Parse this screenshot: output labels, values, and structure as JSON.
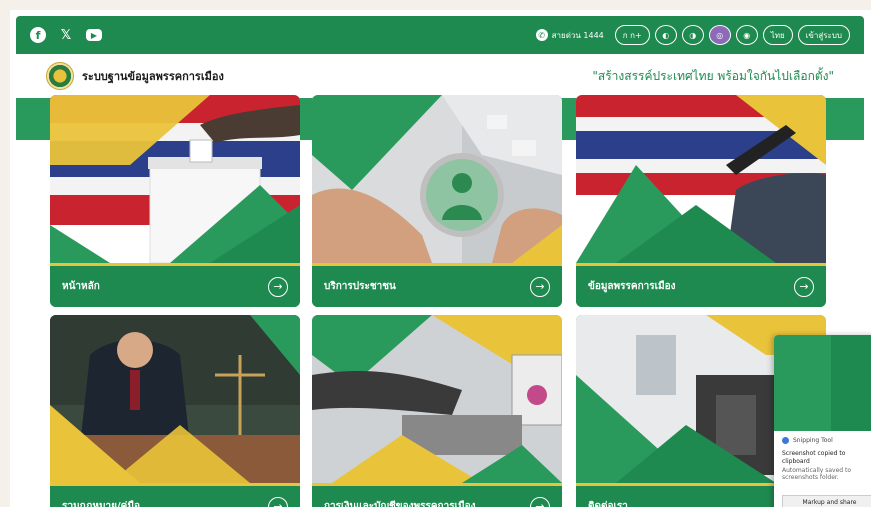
{
  "topbar": {
    "social": [
      "f",
      "𝕏",
      "▶"
    ],
    "hotline": "สายด่วน 1444",
    "buttons": [
      {
        "label": "ก ก+",
        "type": "pill"
      },
      {
        "label": "◐",
        "type": "circ"
      },
      {
        "label": "◑",
        "type": "circ"
      },
      {
        "label": "◎",
        "type": "circ-active"
      },
      {
        "label": "◉",
        "type": "circ"
      },
      {
        "label": "ไทย",
        "type": "pill"
      },
      {
        "label": "เข้าสู่ระบบ",
        "type": "pill"
      }
    ]
  },
  "header": {
    "site_name": "ระบบฐานข้อมูลพรรคการเมือง",
    "slogan": "\"สร้างสรรค์ประเทศไทย พร้อมใจกันไปเลือกตั้ง\""
  },
  "cards": [
    {
      "label": "หน้าหลัก",
      "scene": "ballot"
    },
    {
      "label": "บริการประชาชน",
      "scene": "magnifier"
    },
    {
      "label": "ข้อมูลพรรคการเมือง",
      "scene": "podium"
    },
    {
      "label": "รวมกฎหมาย/คู่มือ",
      "scene": "law"
    },
    {
      "label": "การเงินและบัญชีของพรรคการเมือง",
      "scene": "finance"
    },
    {
      "label": "ติดต่อเรา",
      "scene": "contact"
    }
  ],
  "arrow_icon": "→",
  "toast": {
    "app": "Snipping Tool",
    "message": "Screenshot copied to clipboard",
    "sub": "Automatically saved to screenshots folder.",
    "button": "Markup and share"
  },
  "colors": {
    "primary_green": "#1f8a50",
    "accent_yellow": "#e9c33a",
    "active_purple": "#8c6ab8"
  }
}
